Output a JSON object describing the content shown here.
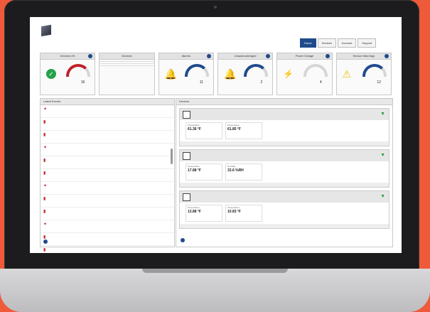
{
  "header": {
    "user_link": "",
    "nav_tabs": [
      {
        "label": "Home",
        "active": true
      },
      {
        "label": "Devices",
        "active": false
      },
      {
        "label": "Account",
        "active": false
      },
      {
        "label": "Support",
        "active": false
      }
    ]
  },
  "widgets": [
    {
      "title": "Devices OK",
      "icon": "check-icon",
      "value": "16",
      "gauge_color": "#c0202a"
    },
    {
      "title": "Devices",
      "badge": "",
      "rows": [
        {
          "label": "",
          "value": ""
        },
        {
          "label": "",
          "value": ""
        },
        {
          "label": "",
          "value": ""
        }
      ]
    },
    {
      "title": "Alarms",
      "icon": "bell-icon",
      "value": "11",
      "gauge_color": "#1f4a8c"
    },
    {
      "title": "Unacknowledged",
      "icon": "bell-warning-icon",
      "value": "2",
      "gauge_color": "#1f4a8c"
    },
    {
      "title": "Power Outage",
      "icon": "power-outage-icon",
      "value": "4",
      "gauge_color": "#1f4a8c"
    },
    {
      "title": "Sensor Warnings",
      "icon": "warning-triangle-icon",
      "value": "12",
      "gauge_color": "#1f4a8c"
    }
  ],
  "events_panel": {
    "title": "Latest Events",
    "events": [
      {
        "name": "",
        "time": ""
      },
      {
        "name": "",
        "time": ""
      },
      {
        "name": "",
        "time": ""
      },
      {
        "name": "",
        "time": ""
      },
      {
        "name": "",
        "time": ""
      },
      {
        "name": "",
        "time": ""
      },
      {
        "name": "",
        "time": ""
      },
      {
        "name": "",
        "time": ""
      },
      {
        "name": "",
        "time": ""
      },
      {
        "name": "",
        "time": ""
      },
      {
        "name": "",
        "time": ""
      },
      {
        "name": "",
        "time": ""
      },
      {
        "name": "",
        "time": ""
      },
      {
        "name": "",
        "time": ""
      }
    ],
    "add_label": ""
  },
  "devices_panel": {
    "title": "Devices",
    "devices": [
      {
        "name": "",
        "serial": "",
        "measurements": [
          {
            "label": "Temperature",
            "value": "61.36 °F"
          },
          {
            "label": "Temperature",
            "value": "61.85 °F"
          }
        ],
        "footer": ""
      },
      {
        "name": "",
        "serial": "",
        "measurements": [
          {
            "label": "Temperature",
            "value": "17.88 °F"
          },
          {
            "label": "Humidity",
            "value": "33.6 %RH"
          }
        ],
        "footer": ""
      },
      {
        "name": "",
        "serial": "",
        "measurements": [
          {
            "label": "Temperature",
            "value": "13.88 °F"
          },
          {
            "label": "Temperature",
            "value": "10.83 °F"
          }
        ],
        "footer": ""
      }
    ],
    "add_label": ""
  },
  "footer": {
    "text": ""
  }
}
